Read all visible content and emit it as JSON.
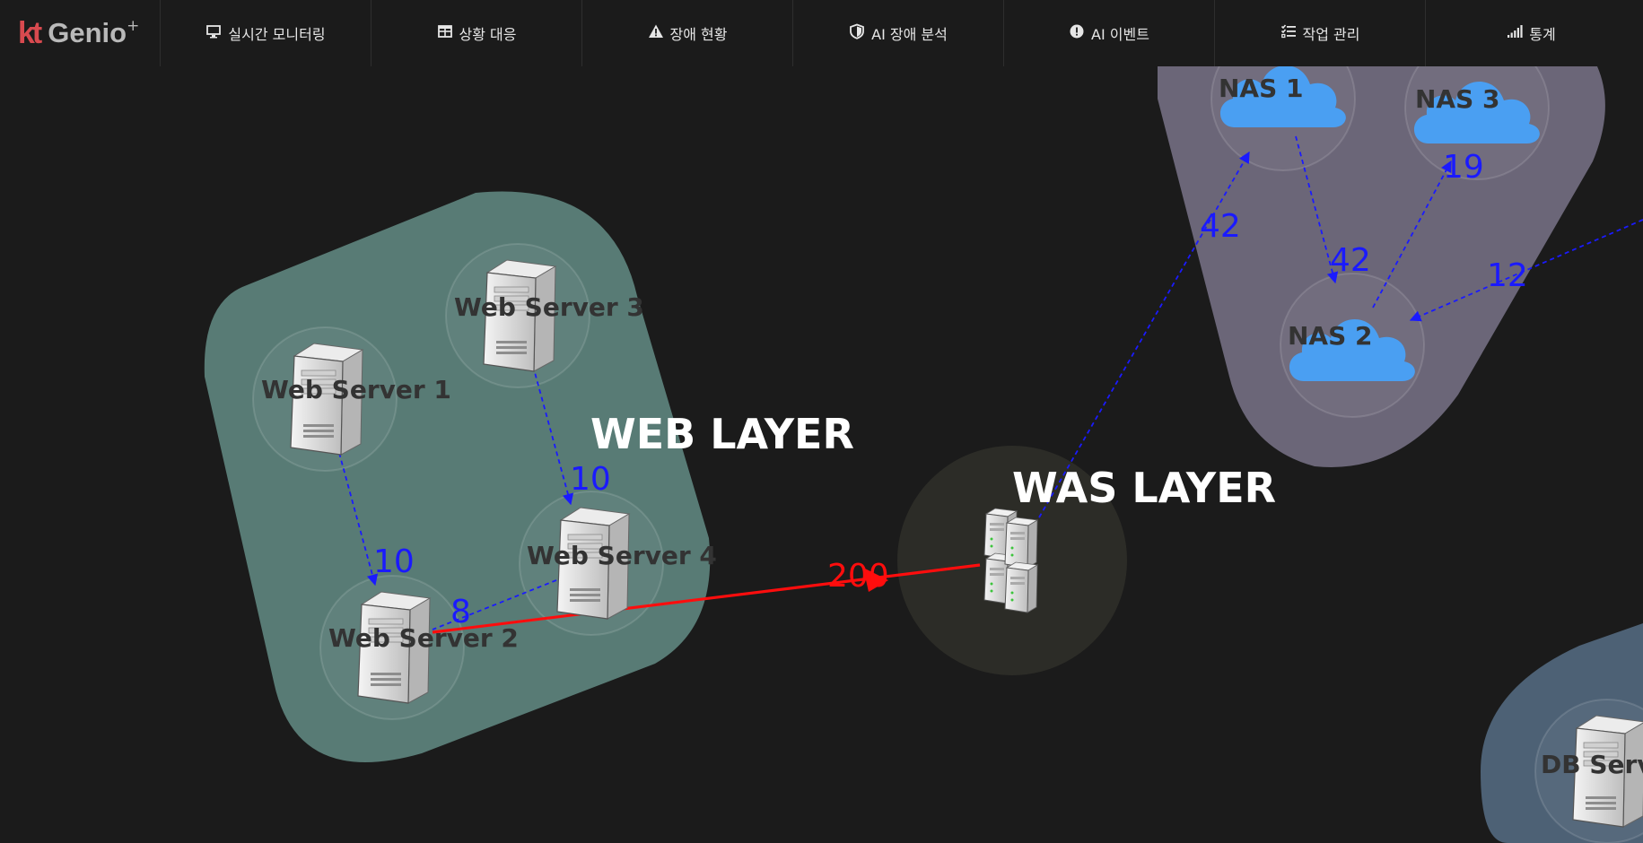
{
  "brand": {
    "kt": "kt",
    "name": "Genio",
    "sup": "+"
  },
  "nav": [
    {
      "label": "실시간 모니터링",
      "icon": "monitor-icon"
    },
    {
      "label": "상황 대응",
      "icon": "grid-icon"
    },
    {
      "label": "장애 현황",
      "icon": "warning-icon"
    },
    {
      "label": "AI 장애 분석",
      "icon": "shield-icon"
    },
    {
      "label": "AI 이벤트",
      "icon": "alert-circle-icon"
    },
    {
      "label": "작업 관리",
      "icon": "checklist-icon"
    },
    {
      "label": "통계",
      "icon": "signal-bars-icon"
    }
  ],
  "groups": {
    "web": {
      "label": "WEB LAYER",
      "color": "#587b75"
    },
    "was": {
      "label": "WAS LAYER",
      "color": "#2c2c27"
    },
    "nas": {
      "color": "#6b6678"
    },
    "db": {
      "color": "#4d6175"
    }
  },
  "nodes": {
    "ws1": "Web Server 1",
    "ws2": "Web Server 2",
    "ws3": "Web Server 3",
    "ws4": "Web Server 4",
    "nas1": "NAS 1",
    "nas2": "NAS 2",
    "nas3": "NAS 3",
    "db": "DB Serv"
  },
  "edges": {
    "ws1_ws2": "10",
    "ws3_ws4": "10",
    "ws4_ws2": "8",
    "ws2_was": "200",
    "was_nas1": "42",
    "nas1_nas2": "42",
    "nas2_nas3": "19",
    "ext_nas2": "12"
  },
  "colors": {
    "edge": "#1a1aff",
    "alert": "#ff0d0d",
    "cloud": "#4a9ff2"
  }
}
